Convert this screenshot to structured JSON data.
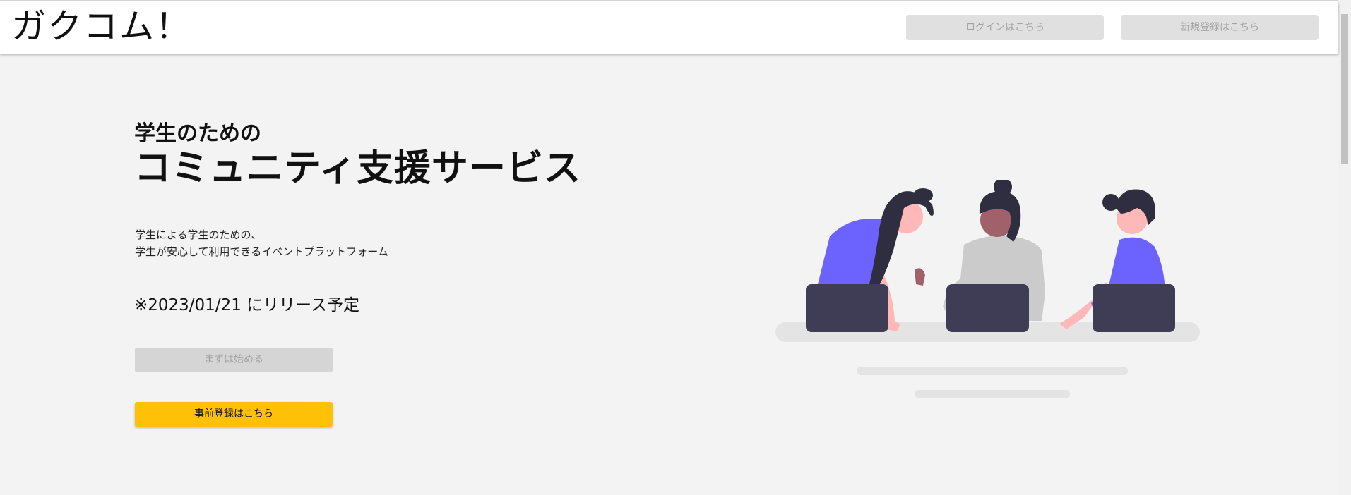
{
  "header": {
    "logo": "ガクコム！",
    "login_label": "ログインはこちら",
    "signup_label": "新規登録はこちら"
  },
  "hero": {
    "subtitle": "学生のための",
    "title": "コミュニティ支援サービス",
    "description_line1": "学生による学生のための、",
    "description_line2": "学生が安心して利用できるイベントプラットフォーム",
    "release_note": "※2023/01/21 にリリース予定",
    "start_label": "まずは始める",
    "preregister_label": "事前登録はこちら"
  },
  "colors": {
    "background": "#f3f3f3",
    "header_bg": "#ffffff",
    "disabled_button": "#e0e0e0",
    "accent_yellow": "#ffc107",
    "illustration_purple": "#6c63ff",
    "laptop_dark": "#3f3d56"
  },
  "icons": {
    "illustration": "team-meeting-illustration"
  }
}
